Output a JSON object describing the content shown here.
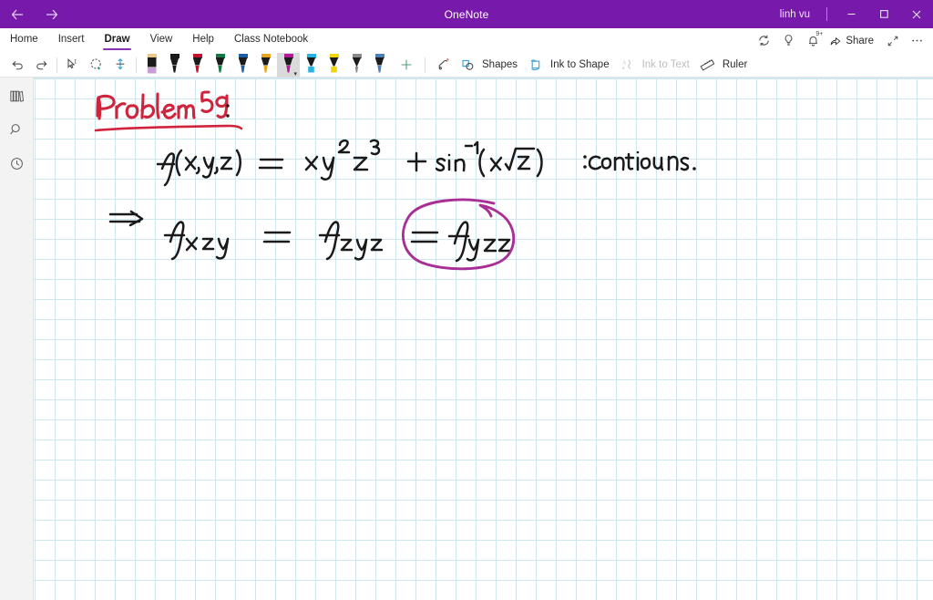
{
  "window": {
    "title": "OneNote",
    "user": "linh vu",
    "back_icon": "back-arrow-icon",
    "forward_icon": "forward-arrow-icon",
    "minimize_label": "Minimize",
    "restore_label": "Restore",
    "close_label": "Close"
  },
  "ribbon": {
    "tabs": [
      {
        "label": "Home",
        "active": false
      },
      {
        "label": "Insert",
        "active": false
      },
      {
        "label": "Draw",
        "active": true
      },
      {
        "label": "View",
        "active": false
      },
      {
        "label": "Help",
        "active": false
      },
      {
        "label": "Class Notebook",
        "active": false
      }
    ],
    "right_actions": [
      {
        "name": "sync-icon",
        "label": "Sync"
      },
      {
        "name": "lightbulb-icon",
        "label": "Tell me what you want to do"
      },
      {
        "name": "notifications-bell-icon",
        "label": "Notifications",
        "badge": "9+"
      },
      {
        "name": "share-button",
        "label": "Share"
      },
      {
        "name": "expand-icon",
        "label": "Full screen"
      },
      {
        "name": "more-options-icon",
        "label": "More options"
      }
    ]
  },
  "toolbar": {
    "undo_label": "Undo",
    "redo_label": "Redo",
    "select_label": "Select",
    "lasso_label": "Lasso Select",
    "insert_space_label": "Insert Space",
    "pens": [
      {
        "name": "pen-pencil-lavender",
        "style": "flat",
        "cap": "#e8c98a",
        "body": "#1b1b1b",
        "tip": "#c79fd4",
        "selected": false
      },
      {
        "name": "pen-black",
        "style": "pen",
        "cap": "#1b1b1b",
        "body": "#1b1b1b",
        "tip": "#1b1b1b",
        "selected": false
      },
      {
        "name": "pen-red",
        "style": "pen",
        "cap": "#c4112f",
        "body": "#1b1b1b",
        "tip": "#c4112f",
        "selected": false
      },
      {
        "name": "pen-green",
        "style": "pen",
        "cap": "#137a43",
        "body": "#1b1b1b",
        "tip": "#137a43",
        "selected": false
      },
      {
        "name": "pen-blue",
        "style": "pen",
        "cap": "#1c5fa8",
        "body": "#1b1b1b",
        "tip": "#1c5fa8",
        "selected": false
      },
      {
        "name": "pen-yellow",
        "style": "pen",
        "cap": "#e8a61c",
        "body": "#1b1b1b",
        "tip": "#e8a61c",
        "selected": false
      },
      {
        "name": "pen-magenta",
        "style": "pen",
        "cap": "#b5189b",
        "body": "#1b1b1b",
        "tip": "#b5189b",
        "selected": true
      },
      {
        "name": "highlighter-cyan",
        "style": "hl",
        "cap": "#2bb3e0",
        "body": "#1b1b1b",
        "tip": "#2bb3e0",
        "selected": false
      },
      {
        "name": "highlighter-yellow",
        "style": "hl",
        "cap": "#f2d50a",
        "body": "#1b1b1b",
        "tip": "#f2d50a",
        "selected": false
      },
      {
        "name": "pencil-gray",
        "style": "pencil",
        "cap": "#8a8a8a",
        "body": "#1b1b1b",
        "tip": "#8a8a8a",
        "selected": false
      },
      {
        "name": "pen-steel-blue",
        "style": "pen",
        "cap": "#4a7fb5",
        "body": "#1b1b1b",
        "tip": "#4a7fb5",
        "selected": false
      }
    ],
    "add_pen_label": "Add Pen",
    "eraser_label": "Eraser",
    "shapes_label": "Shapes",
    "ink_to_shape_label": "Ink to Shape",
    "ink_to_text_label": "Ink to Text",
    "ink_to_text_disabled": true,
    "ruler_label": "Ruler"
  },
  "rail": {
    "items": [
      {
        "name": "notebooks-icon",
        "label": "Notebooks"
      },
      {
        "name": "search-icon",
        "label": "Search"
      },
      {
        "name": "recent-notes-clock-icon",
        "label": "Recent Notes"
      }
    ]
  },
  "page": {
    "ink_color_red": "#d0243c",
    "ink_color_black": "#1a1a1a",
    "ink_color_magenta": "#a82f96",
    "strokes": [
      {
        "name": "heading-problem-59",
        "text": "Problem 59",
        "color": "#d0243c"
      },
      {
        "name": "heading-underline",
        "text": "underline",
        "color": "#d0243c"
      },
      {
        "name": "heading-colon",
        "text": ":",
        "color": "#1a1a1a"
      },
      {
        "name": "equation-line-1",
        "text": "f(x,y,z) = xy²z³ + sin⁻¹(x√z)  :  Continous.",
        "color": "#1a1a1a"
      },
      {
        "name": "equation-line-2",
        "text": "⇒ f_xzy = f_zyz = f_yzz",
        "color": "#1a1a1a"
      },
      {
        "name": "answer-circle",
        "text": "circle around f_yzz",
        "color": "#a82f96"
      }
    ]
  }
}
